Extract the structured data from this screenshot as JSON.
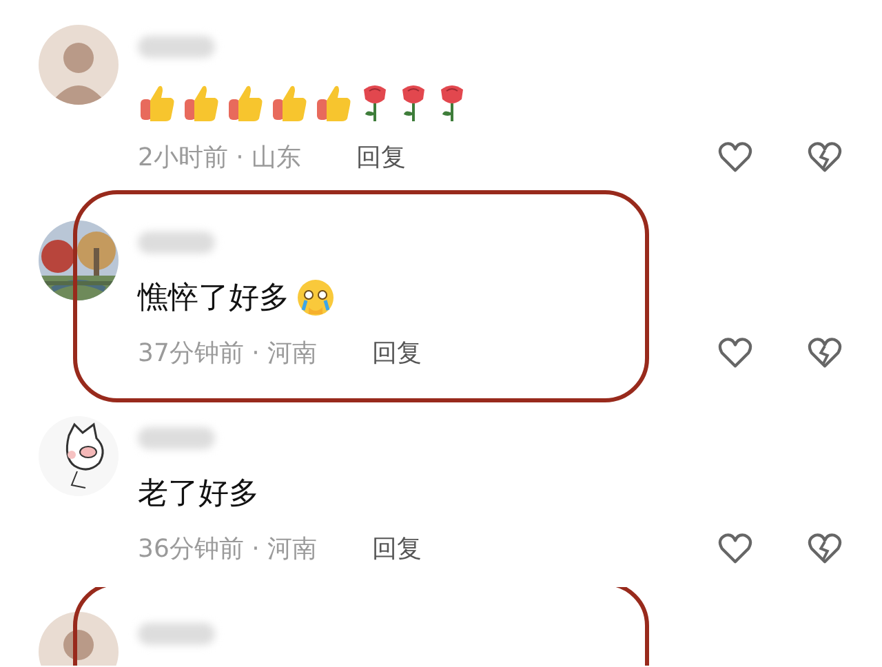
{
  "comments": [
    {
      "avatar": {
        "kind": "person"
      },
      "highlighted": false,
      "body": {
        "emoji": [
          {
            "kind": "thumbs_up"
          },
          {
            "kind": "thumbs_up"
          },
          {
            "kind": "thumbs_up"
          },
          {
            "kind": "thumbs_up"
          },
          {
            "kind": "thumbs_up"
          },
          {
            "kind": "rose"
          },
          {
            "kind": "rose"
          },
          {
            "kind": "rose"
          }
        ]
      },
      "time": "2小时前 · 山东",
      "reply": "回复"
    },
    {
      "avatar": {
        "kind": "landscape"
      },
      "highlighted": true,
      "body": {
        "text": "憔悴了好多",
        "emoji": [
          {
            "kind": "crying"
          }
        ]
      },
      "time": "37分钟前 · 河南",
      "reply": "回复"
    },
    {
      "avatar": {
        "kind": "pig"
      },
      "highlighted": false,
      "body": {
        "text": "老了好多"
      },
      "time": "36分钟前 · 河南",
      "reply": "回复"
    },
    {
      "avatar": {
        "kind": "person"
      },
      "highlighted": true
    }
  ]
}
